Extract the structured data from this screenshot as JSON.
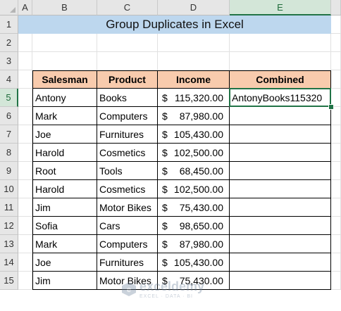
{
  "columns": [
    "A",
    "B",
    "C",
    "D",
    "E"
  ],
  "rows": [
    "1",
    "2",
    "3",
    "4",
    "5",
    "6",
    "7",
    "8",
    "9",
    "10",
    "11",
    "12",
    "13",
    "14",
    "15"
  ],
  "title": "Group Duplicates in Excel",
  "table": {
    "headers": [
      "Salesman",
      "Product",
      "Income",
      "Combined"
    ],
    "currency_symbol": "$",
    "rows": [
      {
        "salesman": "Antony",
        "product": "Books",
        "income": "115,320.00",
        "combined": "AntonyBooks115320"
      },
      {
        "salesman": "Mark",
        "product": "Computers",
        "income": "87,980.00",
        "combined": ""
      },
      {
        "salesman": "Joe",
        "product": "Furnitures",
        "income": "105,430.00",
        "combined": ""
      },
      {
        "salesman": "Harold",
        "product": "Cosmetics",
        "income": "102,500.00",
        "combined": ""
      },
      {
        "salesman": "Root",
        "product": "Tools",
        "income": "68,450.00",
        "combined": ""
      },
      {
        "salesman": "Harold",
        "product": "Cosmetics",
        "income": "102,500.00",
        "combined": ""
      },
      {
        "salesman": "Jim",
        "product": "Motor Bikes",
        "income": "75,430.00",
        "combined": ""
      },
      {
        "salesman": "Sofia",
        "product": "Cars",
        "income": "98,650.00",
        "combined": ""
      },
      {
        "salesman": "Mark",
        "product": "Computers",
        "income": "87,980.00",
        "combined": ""
      },
      {
        "salesman": "Joe",
        "product": "Furnitures",
        "income": "105,430.00",
        "combined": ""
      },
      {
        "salesman": "Jim",
        "product": "Motor Bikes",
        "income": "75,430.00",
        "combined": ""
      }
    ]
  },
  "selection": {
    "column": "E",
    "row": "5"
  },
  "colors": {
    "title_fill": "#bdd7ee",
    "header_fill": "#f8cbad",
    "accent": "#217346"
  },
  "watermark": {
    "name": "exceldemy",
    "tagline": "EXCEL · DATA · BI"
  }
}
